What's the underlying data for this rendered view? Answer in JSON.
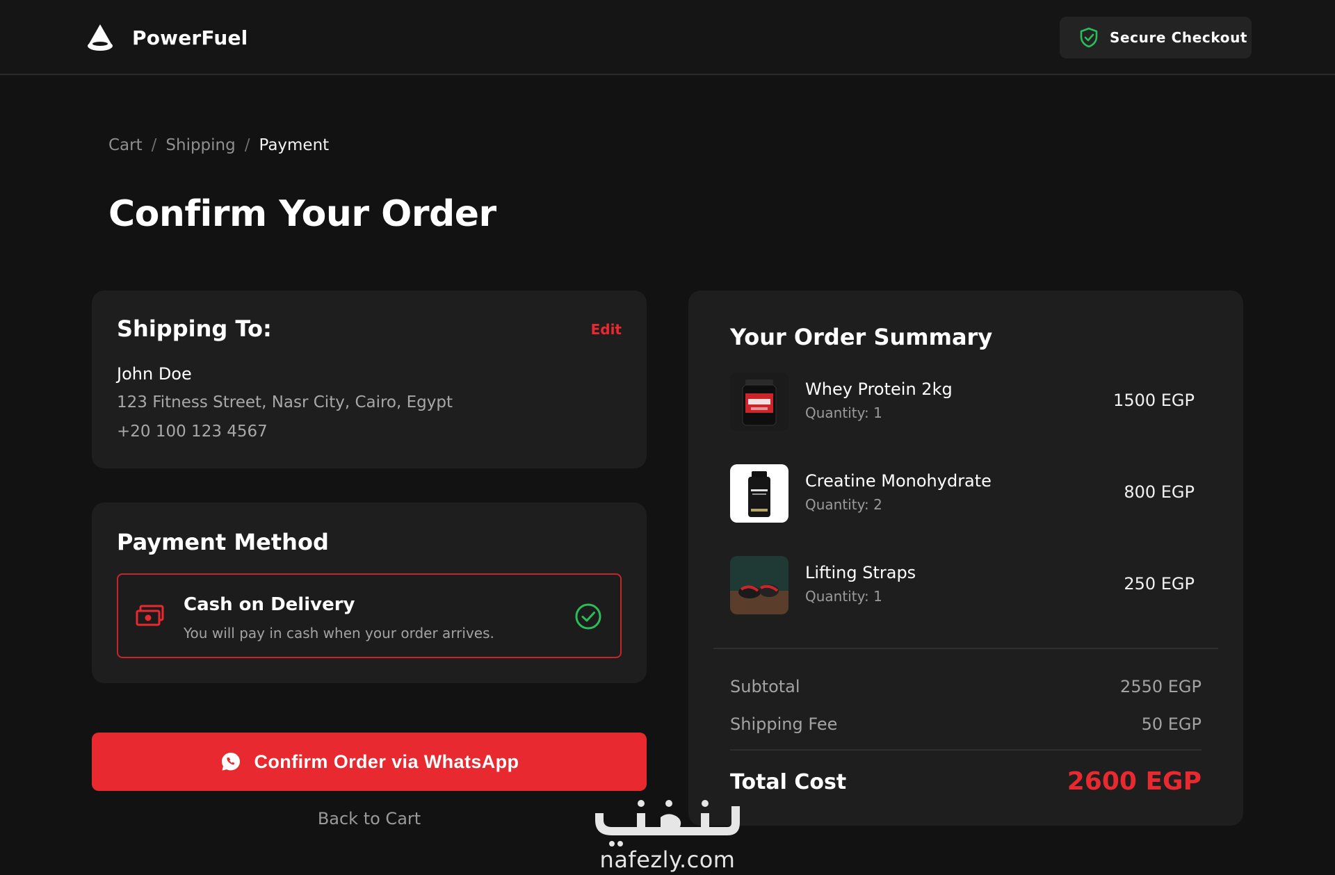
{
  "header": {
    "brand": "PowerFuel",
    "secure_label": "Secure Checkout"
  },
  "breadcrumb": {
    "items": [
      "Cart",
      "Shipping",
      "Payment"
    ],
    "separator": "/"
  },
  "page_title": "Confirm Your Order",
  "shipping": {
    "title": "Shipping To:",
    "edit_label": "Edit",
    "name": "John Doe",
    "address": "123 Fitness Street, Nasr City, Cairo, Egypt",
    "phone": "+20 100 123 4567"
  },
  "payment": {
    "title": "Payment Method",
    "option_label": "Cash on Delivery",
    "option_desc": "You will pay in cash when your order arrives.",
    "selected": true
  },
  "actions": {
    "confirm_label": "Confirm Order via WhatsApp",
    "back_label": "Back to Cart"
  },
  "summary": {
    "title": "Your Order Summary",
    "items": [
      {
        "name": "Whey Protein 2kg",
        "qty": "Quantity: 1",
        "price": "1500 EGP"
      },
      {
        "name": "Creatine Monohydrate",
        "qty": "Quantity: 2",
        "price": "800 EGP"
      },
      {
        "name": "Lifting Straps",
        "qty": "Quantity: 1",
        "price": "250 EGP"
      }
    ],
    "subtotal_label": "Subtotal",
    "subtotal_value": "2550 EGP",
    "shipping_label": "Shipping Fee",
    "shipping_value": "50 EGP",
    "total_label": "Total Cost",
    "total_value": "2600 EGP"
  },
  "watermark": {
    "arabic": "نفذلي",
    "url": "nafezly.com"
  },
  "colors": {
    "accent": "#e8292f",
    "success": "#2bbd5a",
    "background": "#121212",
    "card": "#1e1e1e"
  }
}
